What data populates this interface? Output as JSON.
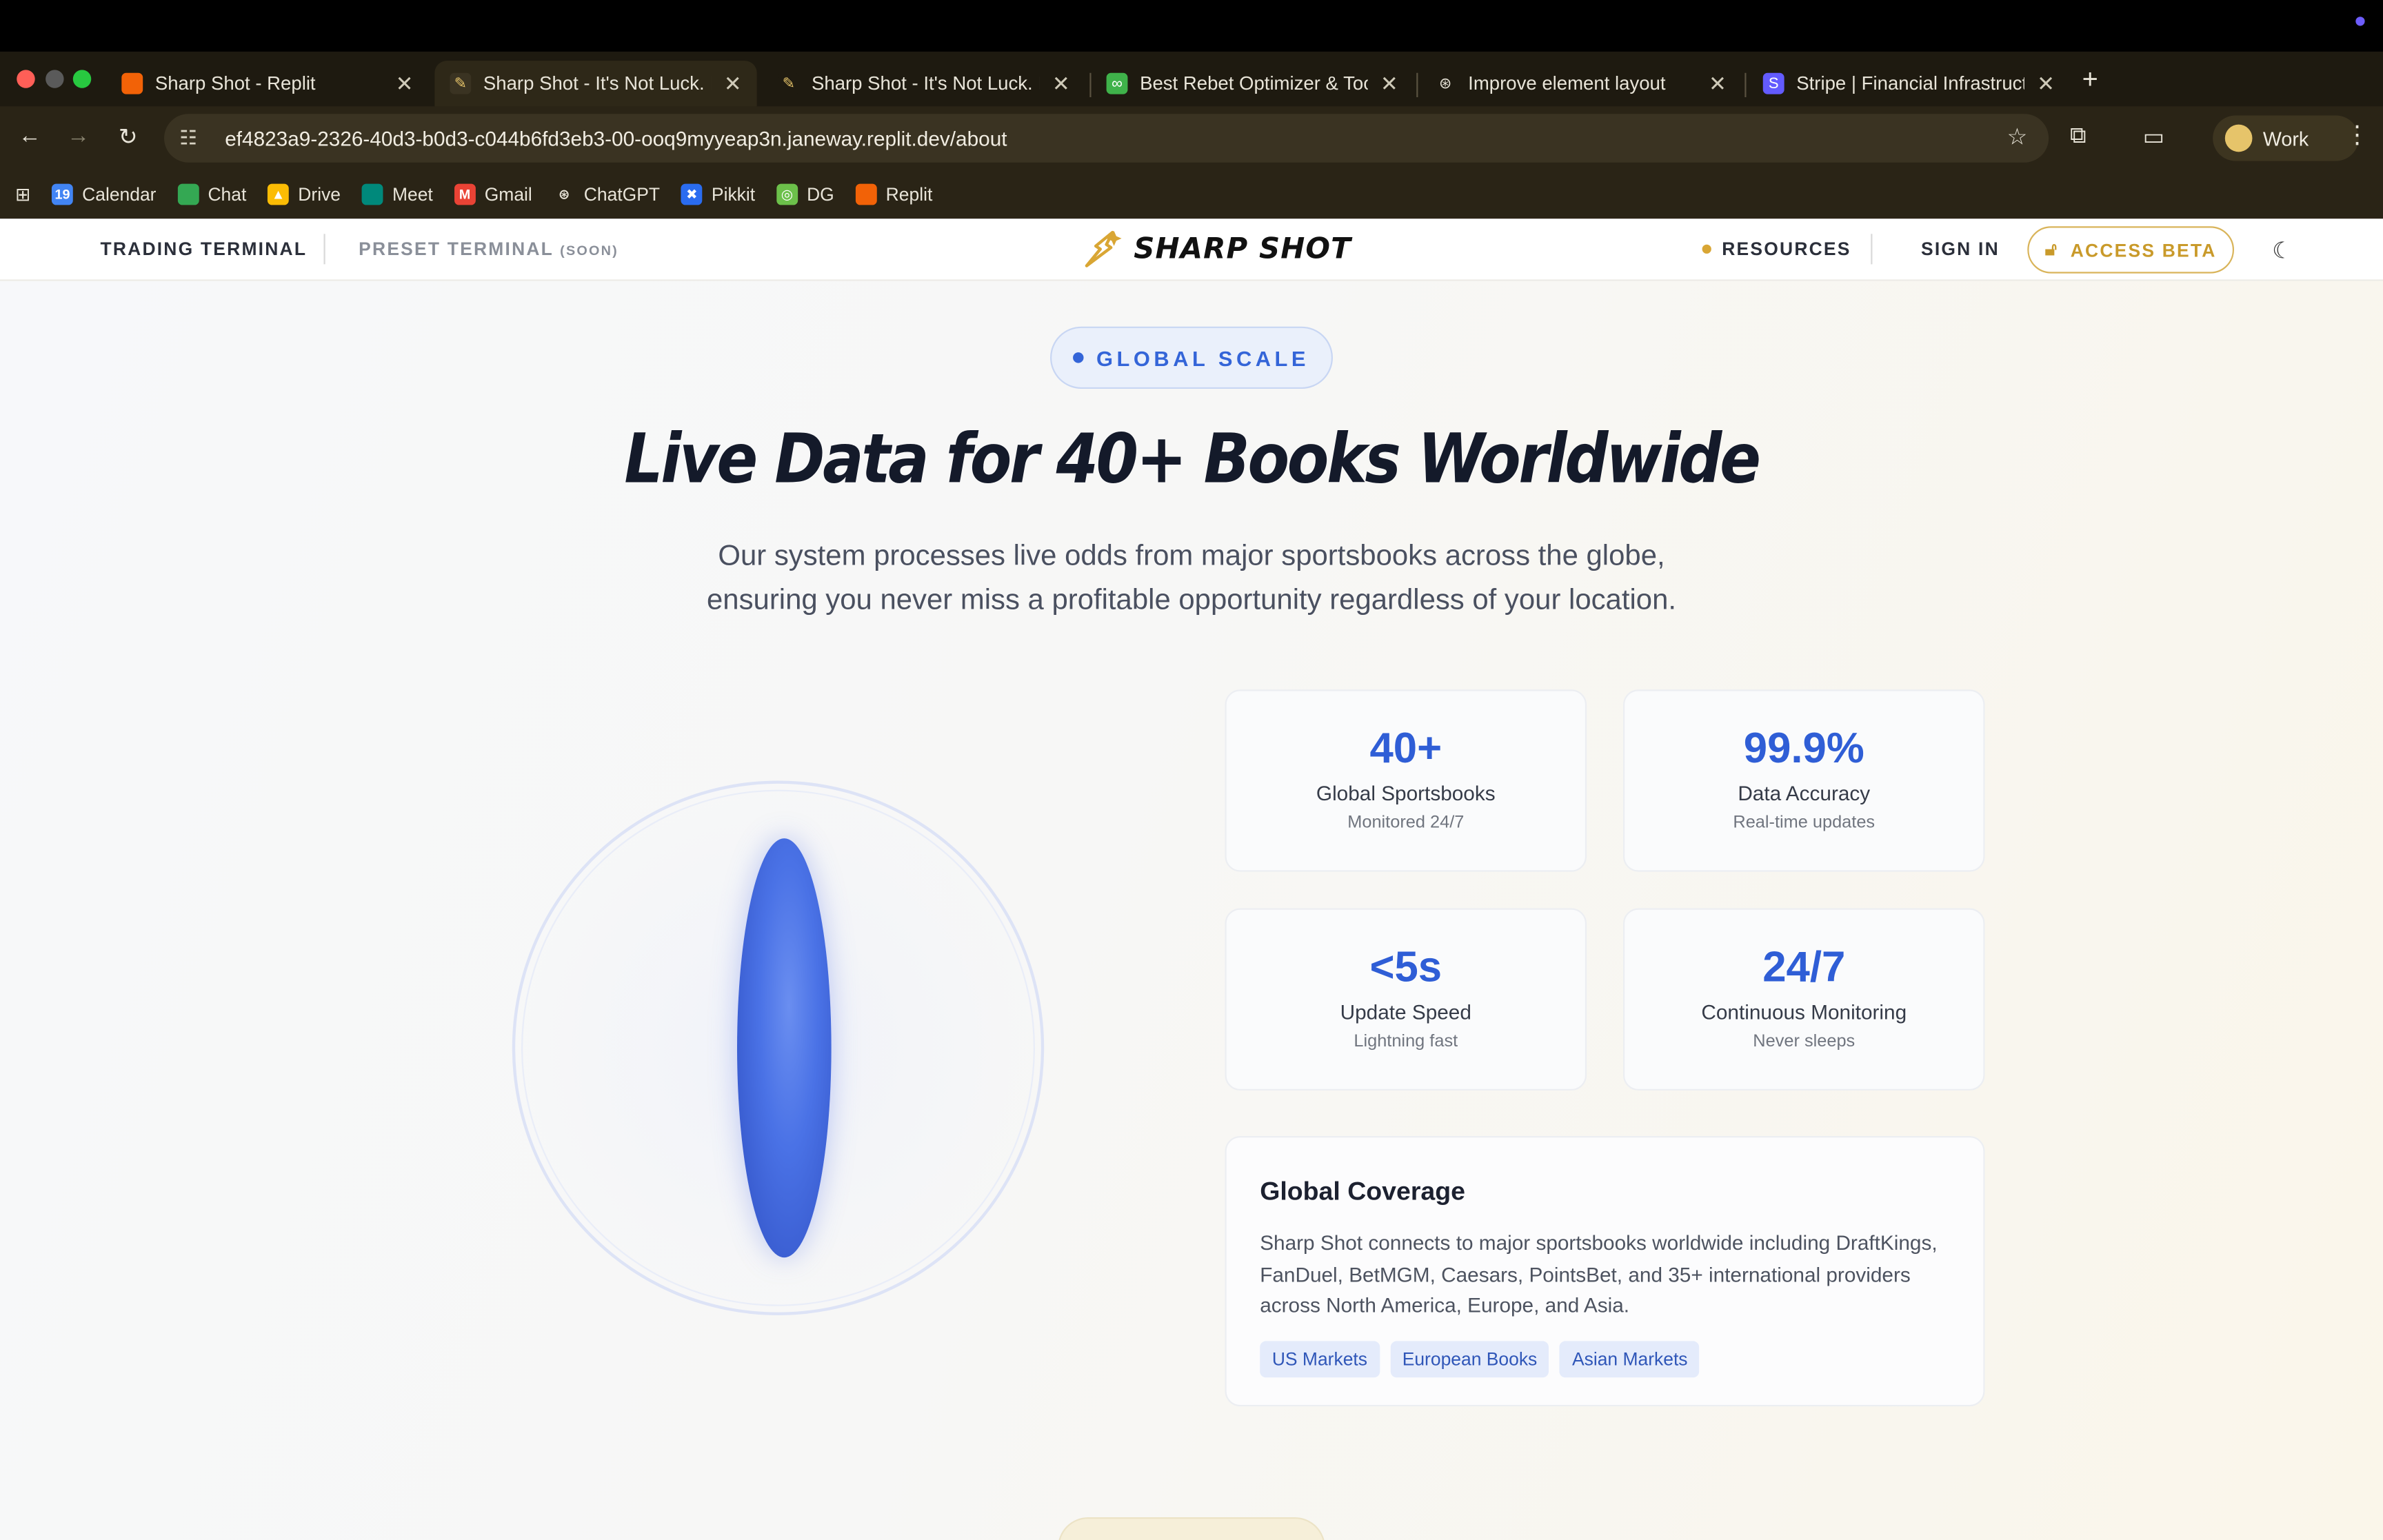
{
  "browser": {
    "tabs": [
      {
        "title": "Sharp Shot - Replit",
        "active": false
      },
      {
        "title": "Sharp Shot - It's Not Luck. It'",
        "active": true
      },
      {
        "title": "Sharp Shot - It's Not Luck. It'",
        "active": false
      },
      {
        "title": "Best Rebet Optimizer & Tools",
        "active": false
      },
      {
        "title": "Improve element layout",
        "active": false
      },
      {
        "title": "Stripe | Financial Infrastructur",
        "active": false
      }
    ],
    "url": "ef4823a9-2326-40d3-b0d3-c044b6fd3eb3-00-ooq9myyeap3n.janeway.replit.dev/about",
    "profile_label": "Work",
    "bookmarks": [
      "Calendar",
      "Chat",
      "Drive",
      "Meet",
      "Gmail",
      "ChatGPT",
      "Pikkit",
      "DG",
      "Replit"
    ],
    "colors": {
      "chrome": "#2a2416",
      "tabstrip": "#1e1a10"
    }
  },
  "site": {
    "nav": {
      "trading_terminal": "TRADING TERMINAL",
      "preset_terminal": "PRESET TERMINAL",
      "soon": "(SOON)",
      "logo": "SHARP SHOT",
      "resources": "RESOURCES",
      "sign_in": "SIGN IN",
      "access_beta": "ACCESS BETA"
    },
    "hero": {
      "badge": "GLOBAL SCALE",
      "title": "Live Data for 40+ Books Worldwide",
      "subtitle_line1": "Our system processes live odds from major sportsbooks across the globe,",
      "subtitle_line2": "ensuring you never miss a profitable opportunity regardless of your location."
    },
    "stats": [
      {
        "value": "40+",
        "label": "Global Sportsbooks",
        "sub": "Monitored 24/7"
      },
      {
        "value": "99.9%",
        "label": "Data Accuracy",
        "sub": "Real-time updates"
      },
      {
        "value": "<5s",
        "label": "Update Speed",
        "sub": "Lightning fast"
      },
      {
        "value": "24/7",
        "label": "Continuous Monitoring",
        "sub": "Never sleeps"
      }
    ],
    "coverage": {
      "heading": "Global Coverage",
      "text": "Sharp Shot connects to major sportsbooks worldwide including DraftKings, FanDuel, BetMGM, Caesars, PointsBet, and 35+ international providers across North America, Europe, and Asia.",
      "tags": [
        "US Markets",
        "European Books",
        "Asian Markets"
      ]
    },
    "colors": {
      "accent": "#2f5ed6",
      "gold": "#d9a634"
    }
  }
}
